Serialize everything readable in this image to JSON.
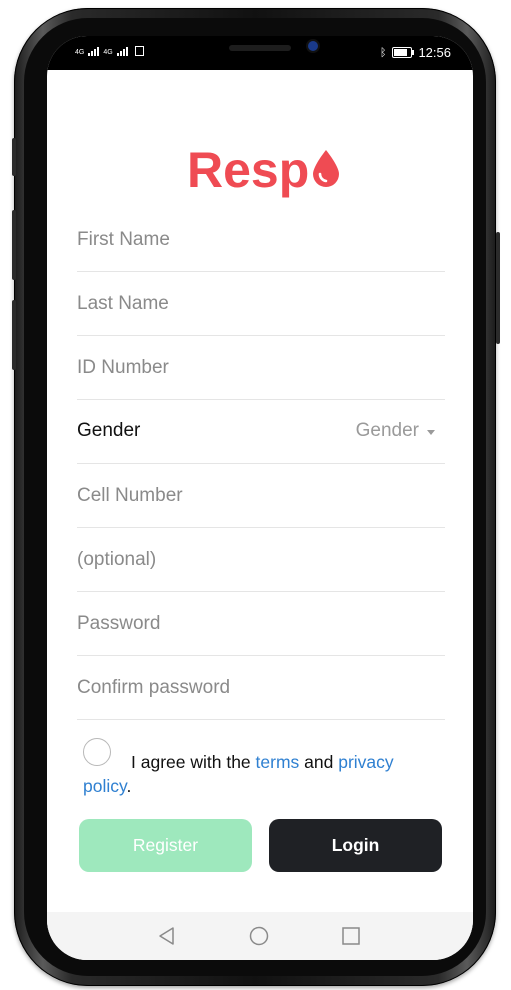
{
  "status_bar": {
    "signal_1": "4G",
    "signal_2": "4G",
    "time": "12:56"
  },
  "app": {
    "logo_text": "Resp",
    "logo_color": "#ef4b53"
  },
  "form": {
    "first_name_placeholder": "First Name",
    "last_name_placeholder": "Last Name",
    "id_number_placeholder": "ID Number",
    "gender_label": "Gender",
    "gender_selected": "Gender",
    "cell_number_placeholder": "Cell Number",
    "optional_placeholder": "(optional)",
    "password_placeholder": "Password",
    "confirm_password_placeholder": "Confirm password"
  },
  "agreement": {
    "text_before": "I agree with the ",
    "terms_link": "terms",
    "text_and": " and ",
    "privacy_link_part1": "privacy",
    "privacy_link_part2": "policy",
    "text_end": ".",
    "link_color": "#2f80d1"
  },
  "buttons": {
    "register_label": "Register",
    "login_label": "Login",
    "register_color": "#9ee8bd",
    "login_color": "#1f2125"
  },
  "nav_bar": {
    "back_icon": "triangle-back-icon",
    "home_icon": "circle-home-icon",
    "recents_icon": "square-recents-icon"
  }
}
